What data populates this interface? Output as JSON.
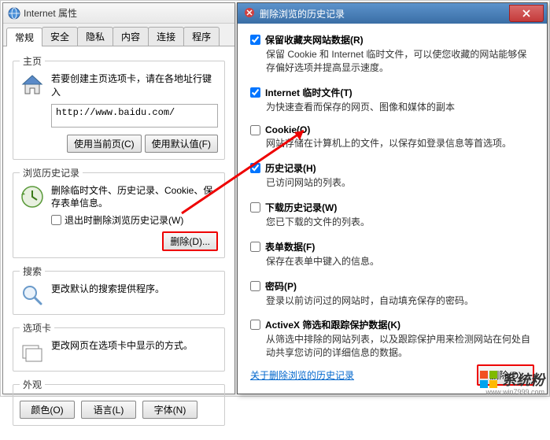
{
  "leftDialog": {
    "title": "Internet 属性",
    "tabs": [
      "常规",
      "安全",
      "隐私",
      "内容",
      "连接",
      "程序"
    ],
    "activeTab": 0,
    "homepage": {
      "legend": "主页",
      "text": "若要创建主页选项卡，请在各地址行键入",
      "url": "http://www.baidu.com/",
      "btnCurrent": "使用当前页(C)",
      "btnDefault": "使用默认值(F)"
    },
    "history": {
      "legend": "浏览历史记录",
      "text": "删除临时文件、历史记录、Cookie、保存表单信息。",
      "checkboxLabel": "退出时删除浏览历史记录(W)",
      "deleteBtn": "删除(D)..."
    },
    "search": {
      "legend": "搜索",
      "text": "更改默认的搜索提供程序。"
    },
    "tabsSection": {
      "legend": "选项卡",
      "text": "更改网页在选项卡中显示的方式。"
    },
    "appearance": {
      "legend": "外观",
      "btnColor": "颜色(O)",
      "btnLang": "语言(L)",
      "btnFont": "字体(N)"
    }
  },
  "rightDialog": {
    "title": "删除浏览的历史记录",
    "options": [
      {
        "label": "保留收藏夹网站数据(R)",
        "checked": true,
        "desc": "保留 Cookie 和 Internet 临时文件，可以使您收藏的网站能够保存偏好选项并提高显示速度。"
      },
      {
        "label": "Internet 临时文件(T)",
        "checked": true,
        "desc": "为快速查看而保存的网页、图像和媒体的副本"
      },
      {
        "label": "Cookie(O)",
        "checked": false,
        "desc": "网站存储在计算机上的文件，以保存如登录信息等首选项。"
      },
      {
        "label": "历史记录(H)",
        "checked": true,
        "desc": "已访问网站的列表。"
      },
      {
        "label": "下载历史记录(W)",
        "checked": false,
        "desc": "您已下载的文件的列表。"
      },
      {
        "label": "表单数据(F)",
        "checked": false,
        "desc": "保存在表单中键入的信息。"
      },
      {
        "label": "密码(P)",
        "checked": false,
        "desc": "登录以前访问过的网站时，自动填充保存的密码。"
      },
      {
        "label": "ActiveX 筛选和跟踪保护数据(K)",
        "checked": false,
        "desc": "从筛选中排除的网站列表，以及跟踪保护用来检测网站在何处自动共享您访问的详细信息的数据。"
      }
    ],
    "link": "关于删除浏览的历史记录",
    "deleteBtn": "删除(D)"
  },
  "watermark": {
    "text": "系统粉",
    "url": "www.win7999.com"
  }
}
